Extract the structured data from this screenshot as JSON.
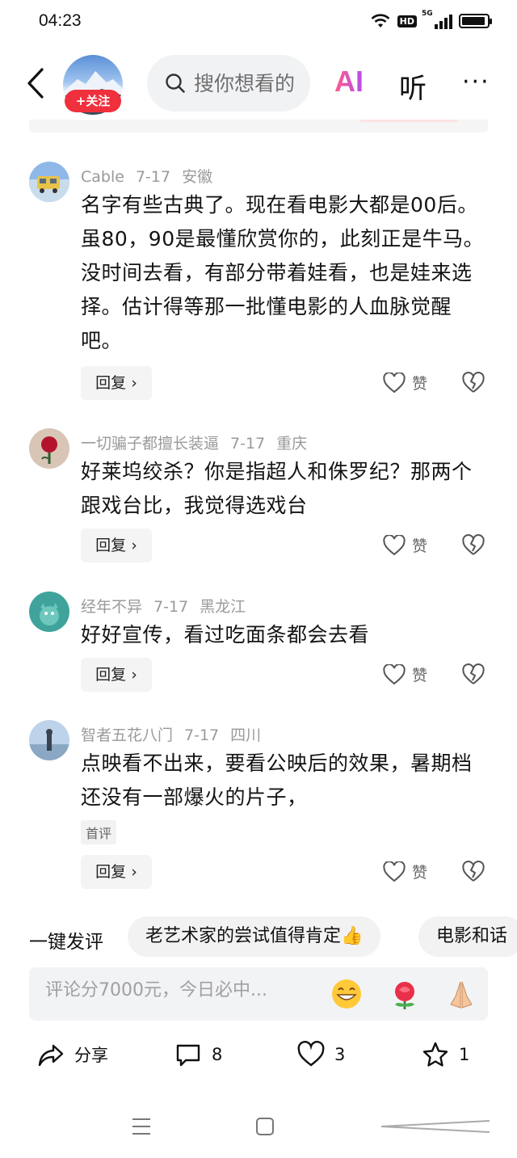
{
  "status": {
    "time": "04:23",
    "hd": "HD",
    "signal": "5G",
    "battery_level": 0.92
  },
  "header": {
    "follow_label": "+关注",
    "search_placeholder": "搜你想看的",
    "ai_label": "AI",
    "listen_label": "听",
    "more_label": "···"
  },
  "comments": [
    {
      "user": "Cable",
      "date": "7-17",
      "location": "安徽",
      "text": "名字有些古典了。现在看电影大都是00后。虽80，90是最懂欣赏你的，此刻正是牛马。没时间去看，有部分带着娃看，也是娃来选择。估计得等那一批懂电影的人血脉觉醒吧。",
      "reply_label": "回复 ›",
      "like_label": "赞"
    },
    {
      "user": "一切骗子都擅长装逼",
      "date": "7-17",
      "location": "重庆",
      "text": "好莱坞绞杀？你是指超人和侏罗纪？那两个跟戏台比，我觉得选戏台",
      "reply_label": "回复 ›",
      "like_label": "赞"
    },
    {
      "user": "经年不异",
      "date": "7-17",
      "location": "黑龙江",
      "text": "好好宣传，看过吃面条都会去看",
      "reply_label": "回复 ›",
      "like_label": "赞"
    },
    {
      "user": "智者五花八门",
      "date": "7-17",
      "location": "四川",
      "text": "点映看不出来，要看公映后的效果，暑期档还没有一部爆火的片子，",
      "badge": "首评",
      "reply_label": "回复 ›",
      "like_label": "赞"
    }
  ],
  "quick": {
    "label": "一键发评",
    "chips": [
      "老艺术家的尝试值得肯定👍",
      "电影和话"
    ]
  },
  "comment_input": {
    "placeholder": "评论分7000元，今日必中..."
  },
  "actions": {
    "share_label": "分享",
    "comment_count": "8",
    "like_count": "3",
    "favorite_count": "1"
  },
  "colors": {
    "accent_red": "#f0303c",
    "ai_gradient_start": "#ff5b8a",
    "ai_gradient_end": "#b44cf0"
  }
}
